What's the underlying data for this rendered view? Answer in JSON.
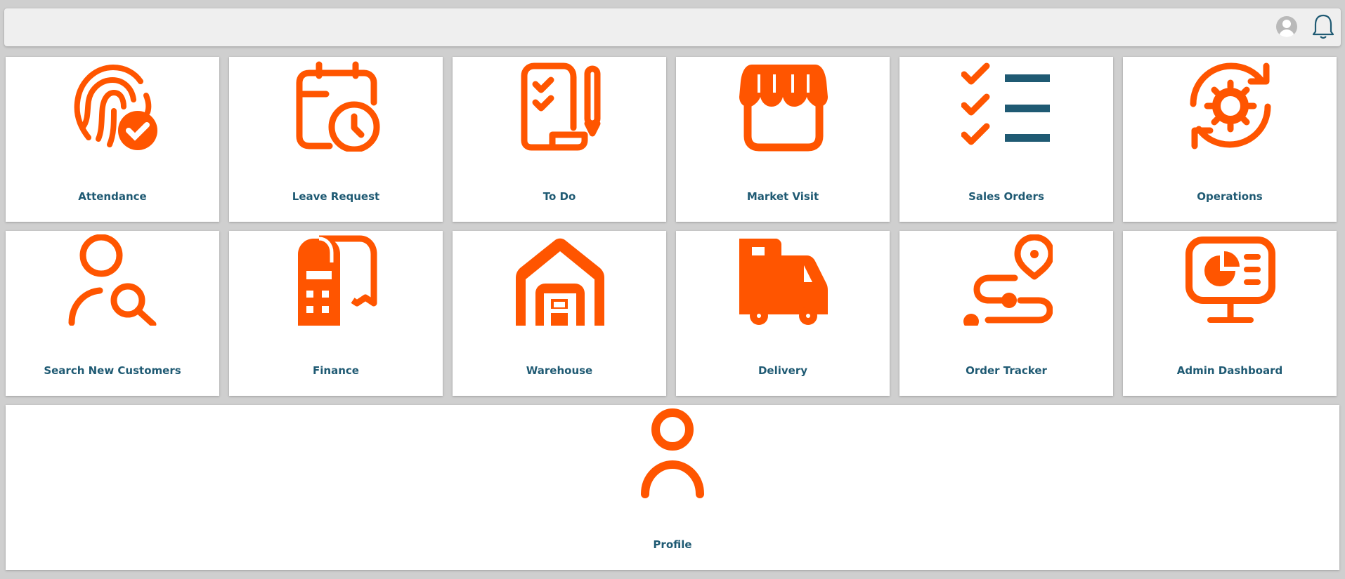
{
  "header": {
    "avatar_icon": "user-avatar-icon",
    "notification_icon": "bell-icon"
  },
  "accent_color": "#ff5500",
  "label_color": "#1f5a73",
  "tiles": [
    {
      "label": "Attendance",
      "icon": "fingerprint-check-icon"
    },
    {
      "label": "Leave Request",
      "icon": "calendar-clock-icon"
    },
    {
      "label": "To Do",
      "icon": "checklist-pencil-icon"
    },
    {
      "label": "Market Visit",
      "icon": "store-icon"
    },
    {
      "label": "Sales Orders",
      "icon": "task-list-icon"
    },
    {
      "label": "Operations",
      "icon": "gear-refresh-icon"
    },
    {
      "label": "Search New Customers",
      "icon": "user-search-icon"
    },
    {
      "label": "Finance",
      "icon": "calculator-receipt-icon"
    },
    {
      "label": "Warehouse",
      "icon": "warehouse-icon"
    },
    {
      "label": "Delivery",
      "icon": "delivery-truck-icon"
    },
    {
      "label": "Order Tracker",
      "icon": "route-pin-icon"
    },
    {
      "label": "Admin Dashboard",
      "icon": "monitor-chart-icon"
    },
    {
      "label": "Profile",
      "icon": "user-profile-icon"
    }
  ]
}
